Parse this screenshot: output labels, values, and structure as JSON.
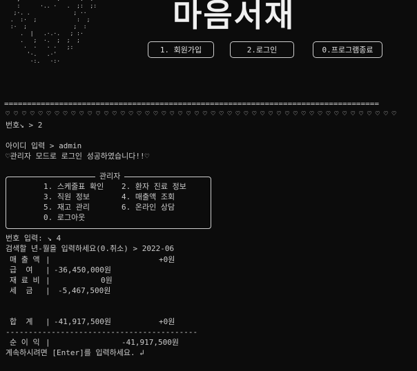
{
  "header": {
    "title": "마음서재",
    "menu": [
      {
        "label": "1. 회원가입"
      },
      {
        "label": "2.로그인"
      },
      {
        "label": "0.프로그램종료"
      }
    ]
  },
  "divider": "==================================================================================",
  "hearts": [
    "♡",
    "♡",
    "♡",
    "♡",
    "♡",
    "♡",
    "♡",
    "♡",
    "♡",
    "♡",
    "♡",
    "♡",
    "♡",
    "♡",
    "♡",
    "♡",
    "♡",
    "♡",
    "♡",
    "♡",
    "♡",
    "♡",
    "♡",
    "♡",
    "♡",
    "♡",
    "♡",
    "♡",
    "♡",
    "♡",
    "♡",
    "♡",
    "♡",
    "♡",
    "♡",
    "♡",
    "♡",
    "♡",
    "♡",
    "♡",
    "♡",
    "♡",
    "♡",
    "♡",
    "♡",
    "♡",
    "♡",
    "♡"
  ],
  "console": {
    "select_line": "번호↘ > 2",
    "id_line": "아이디 입력 > admin",
    "login_msg": "♡관리자 모드로 로그인 성공하였습니다!!♡"
  },
  "admin_menu": {
    "title": "관리자",
    "items": [
      "1. 스케줄표 확인",
      "2. 환자 진료 정보",
      "3. 직원 정보",
      "4. 매출액 조회",
      "5. 재고 관리",
      "6. 온라인 상담",
      "0. 로그아웃"
    ]
  },
  "query": {
    "number_line": "번호 입력: ↘ 4",
    "prompt_line": "검색할 년-월을 입력하세요(0.취소) > 2022-06"
  },
  "report": {
    "rows": [
      {
        "label": "매 출 액",
        "expense": "",
        "income": "+0원"
      },
      {
        "label": "급  여",
        "expense": "-36,450,000원",
        "income": ""
      },
      {
        "label": "재 료 비",
        "expense": "0원",
        "income": ""
      },
      {
        "label": "세  금",
        "expense": "-5,467,500원",
        "income": ""
      }
    ],
    "total": {
      "label": "합  계",
      "expense": "-41,917,500원",
      "income": "+0원"
    },
    "separator": "------------------------------------------",
    "net": {
      "label": "순 이 익",
      "value": "-41,917,500원"
    }
  },
  "footer": {
    "continue_msg": "계속하시려면 [Enter]를 입력하세요. ↲"
  }
}
